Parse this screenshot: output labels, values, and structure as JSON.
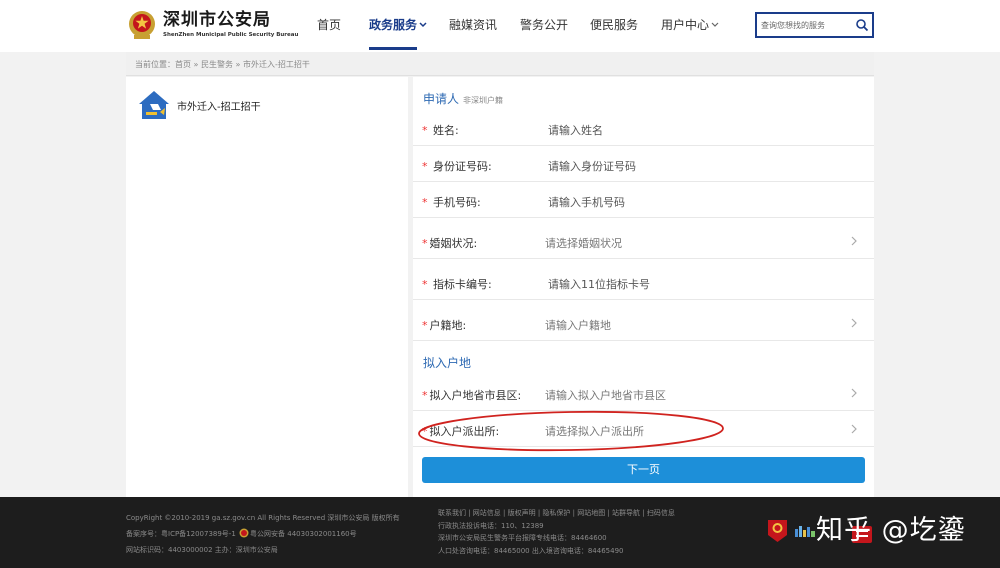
{
  "header": {
    "logo_cn": "深圳市公安局",
    "logo_en": "ShenZhen Municipal Public Security Bureau",
    "nav": [
      {
        "label": "首页"
      },
      {
        "label": "政务服务"
      },
      {
        "label": "融媒资讯"
      },
      {
        "label": "警务公开"
      },
      {
        "label": "便民服务"
      },
      {
        "label": "用户中心"
      }
    ],
    "search_placeholder": "查询您想找的服务"
  },
  "breadcrumb": "当前位置：首页 » 民生警务 » 市外迁入-招工招干",
  "service": {
    "title": "市外迁入-招工招干"
  },
  "form": {
    "applicant_heading": "申请人",
    "applicant_sub": "非深圳户籍",
    "rows": [
      {
        "label": "姓名:",
        "value": "请输入姓名"
      },
      {
        "label": "身份证号码:",
        "value": "请输入身份证号码"
      },
      {
        "label": "手机号码:",
        "value": "请输入手机号码"
      },
      {
        "label": "婚姻状况:",
        "value": "请选择婚姻状况"
      },
      {
        "label": "指标卡编号:",
        "value": "请输入11位指标卡号"
      },
      {
        "label": "户籍地:",
        "value": "请输入户籍地"
      }
    ],
    "destination_heading": "拟入户地",
    "dest_rows": [
      {
        "label": "拟入户地省市县区:",
        "value": "请输入拟入户地省市县区"
      },
      {
        "label": "拟入户派出所:",
        "value": "请选择拟入户派出所"
      }
    ],
    "required_mark": "*",
    "next_label": "下一页"
  },
  "footer": {
    "copyright": "CopyRight ©2010-2019 ga.sz.gov.cn All Rights Reserved 深圳市公安局 版权所有",
    "icp_prefix": "备案序号：粤ICP备12007389号-1",
    "icp_suffix": "粤公网安备 44030302001160号",
    "site_code": "网站标识码：4403000002   主办：深圳市公安局",
    "links": "联系我们 | 网站信息 | 版权声明 | 隐私保护 | 网站地图 | 站群导航 | 扫码信息",
    "line2": "行政执法投诉电话：110、12389",
    "line3": "深圳市公安局民生警务平台报障专线电话：84464600",
    "line4": "人口处咨询电话：84465000 出入境咨询电话：84465490",
    "watermark": "知乎 @圪鎏"
  }
}
